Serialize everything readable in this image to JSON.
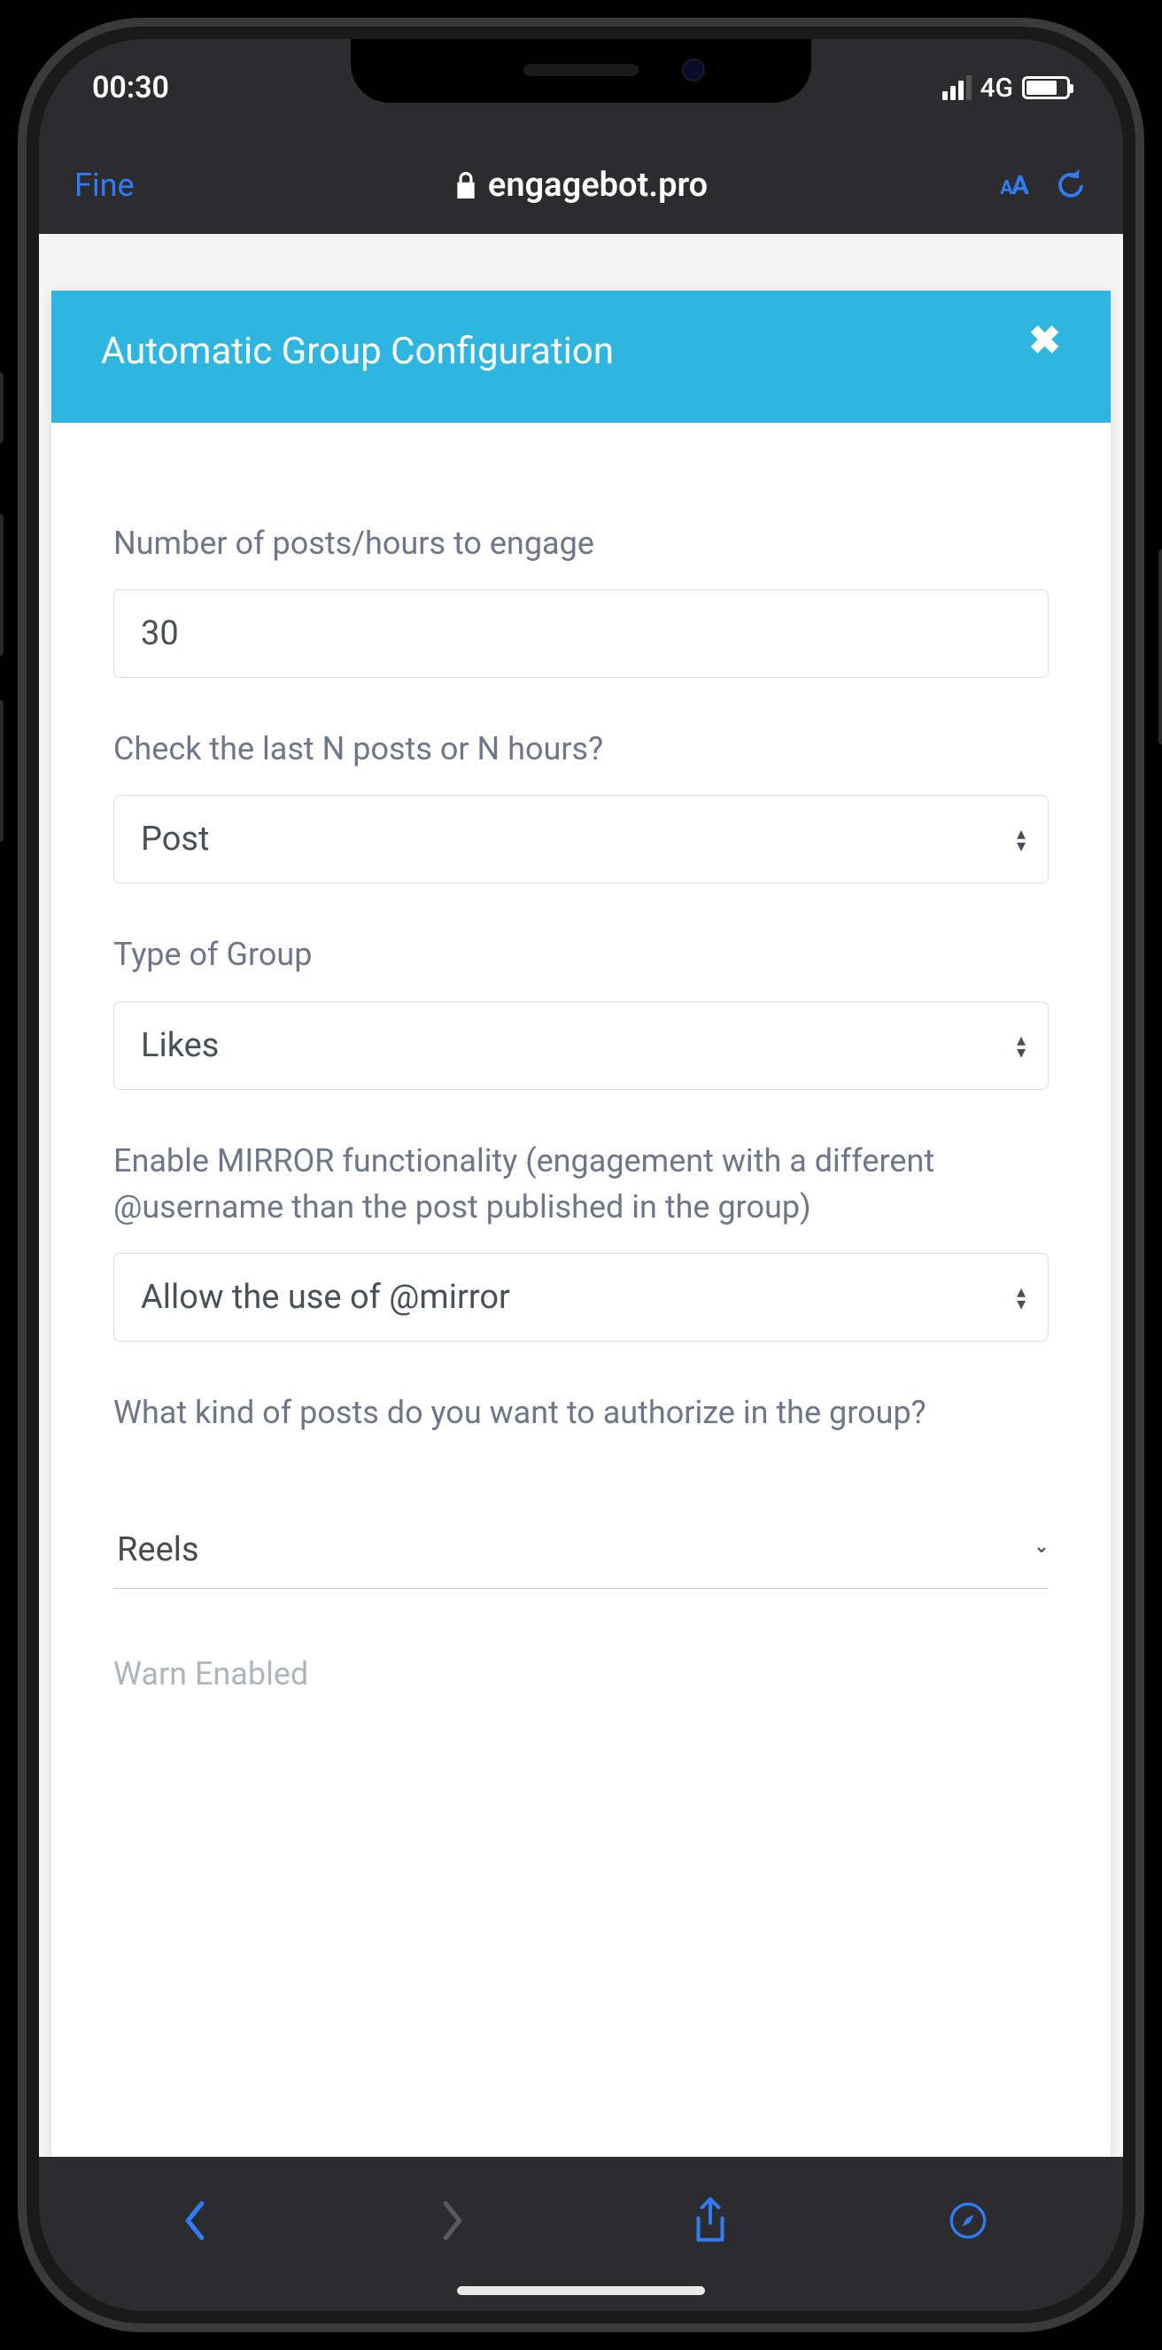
{
  "status": {
    "time": "00:30",
    "network": "4G"
  },
  "browser": {
    "left_action": "Fine",
    "domain": "engagebot.pro",
    "aa_label": "aA"
  },
  "modal": {
    "title": "Automatic Group Configuration"
  },
  "form": {
    "posts_count": {
      "label": "Number of posts/hours to engage",
      "value": "30"
    },
    "check_mode": {
      "label": "Check the last N posts or N hours?",
      "value": "Post"
    },
    "group_type": {
      "label": "Type of Group",
      "value": "Likes"
    },
    "mirror": {
      "label": "Enable MIRROR functionality (engagement with a different @username than the post published in the group)",
      "value": "Allow the use of @mirror"
    },
    "post_kind": {
      "label": "What kind of posts do you want to authorize in the group?",
      "value": "Reels"
    },
    "warn": {
      "label": "Warn Enabled"
    }
  }
}
